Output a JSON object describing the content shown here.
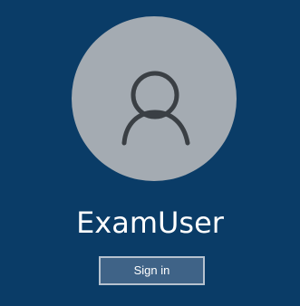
{
  "user": {
    "name": "ExamUser",
    "avatar_icon": "user-silhouette-icon"
  },
  "actions": {
    "signin_label": "Sign in"
  },
  "colors": {
    "background": "#0a3c67",
    "avatar_fill": "#a4abb2",
    "avatar_stroke": "#3a3f44",
    "button_fill": "#3f6387",
    "button_border": "#b6c2cf",
    "text": "#ffffff"
  }
}
